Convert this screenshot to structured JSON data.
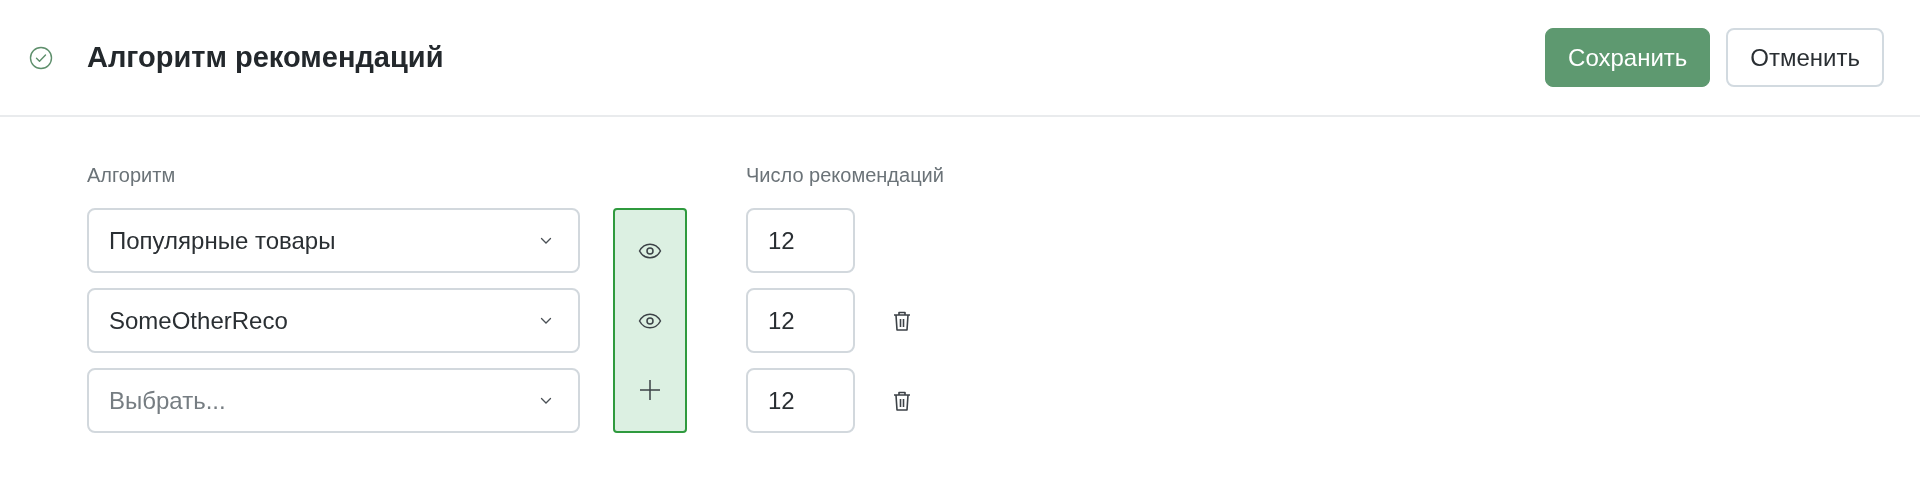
{
  "header": {
    "title": "Алгоритм рекомендаций",
    "buttons": [
      {
        "label": "Сохранить",
        "kind": "primary"
      },
      {
        "label": "Отменить",
        "kind": "secondary"
      }
    ]
  },
  "form": {
    "algorithm_label": "Алгоритм",
    "count_label": "Число рекомендаций",
    "rows": [
      {
        "value": "Популярные товары",
        "kind": "preview",
        "count": "12",
        "deletable": false
      },
      {
        "value": "SomeOtherReco",
        "kind": "preview",
        "count": "12",
        "deletable": true
      },
      {
        "placeholder": "Выбрать...",
        "kind": "add",
        "count": "12",
        "deletable": true
      }
    ]
  }
}
